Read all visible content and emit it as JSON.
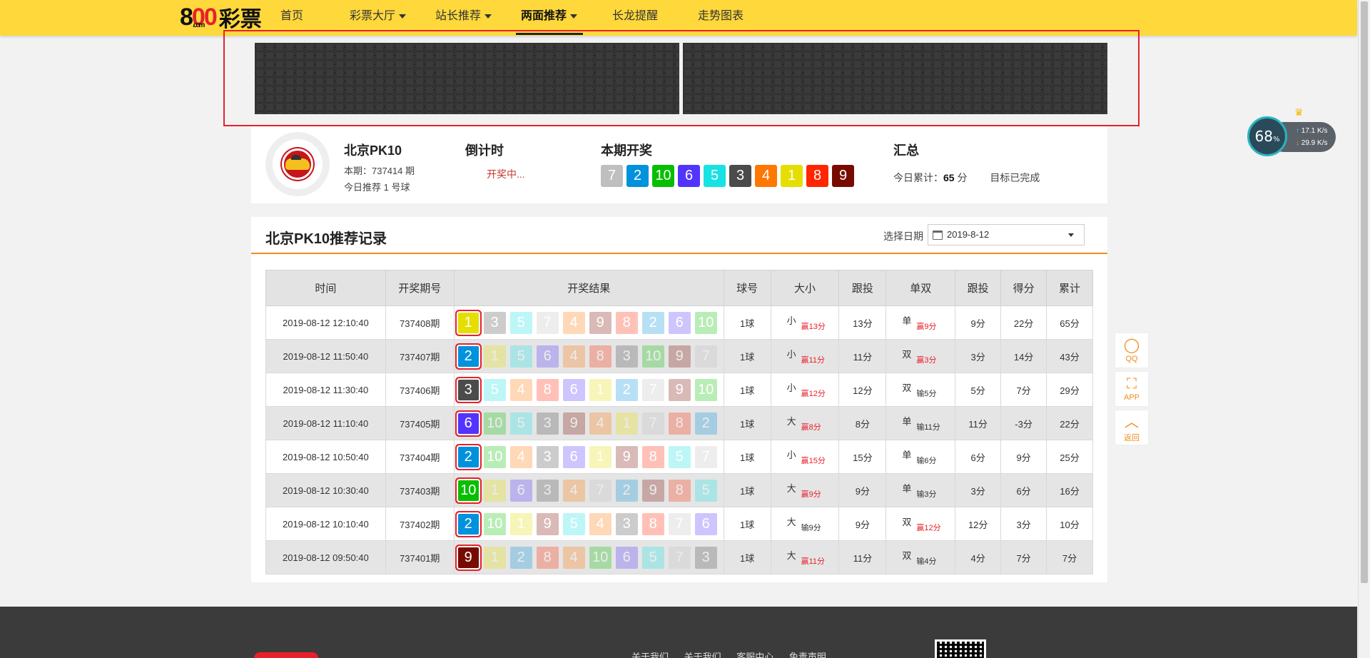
{
  "nav": {
    "logo_num": "8",
    "logo_oo": "00",
    "logo_com": ".com",
    "logo_text": "彩票",
    "items": [
      {
        "label": "首页",
        "dropdown": false,
        "active": false
      },
      {
        "label": "彩票大厅",
        "dropdown": true,
        "active": false
      },
      {
        "label": "站长推荐",
        "dropdown": true,
        "active": false
      },
      {
        "label": "两面推荐",
        "dropdown": true,
        "active": true
      },
      {
        "label": "长龙提醒",
        "dropdown": false,
        "active": false
      },
      {
        "label": "走势图表",
        "dropdown": false,
        "active": false
      }
    ]
  },
  "game": {
    "name": "北京PK10",
    "issue": "本期：737414 期",
    "today": "今日推荐 1 号球"
  },
  "countdown": {
    "title": "倒计时",
    "value": "开奖中..."
  },
  "current_draw": {
    "title": "本期开奖",
    "balls": [
      7,
      2,
      10,
      6,
      5,
      3,
      4,
      1,
      8,
      9
    ]
  },
  "summary": {
    "title": "汇总",
    "prefix": "今日累计：",
    "score": "65",
    "unit": " 分",
    "goal": "目标已完成"
  },
  "ball_colors": {
    "1": "#e6de00",
    "2": "#0092dd",
    "3": "#4b4b4b",
    "4": "#ff7600",
    "5": "#17e2e5",
    "6": "#5234ff",
    "7": "#bfbfbf",
    "8": "#ff2600",
    "9": "#780b00",
    "10": "#07bf00"
  },
  "record": {
    "title": "北京PK10推荐记录",
    "date_label": "选择日期",
    "date_value": "2019-8-12",
    "headers": [
      "时间",
      "开奖期号",
      "开奖结果",
      "球号",
      "大小",
      "跟投",
      "单双",
      "跟投",
      "得分",
      "累计"
    ],
    "rows": [
      {
        "time": "2019-08-12 12:10:40",
        "issue": "737408期",
        "balls": [
          1,
          3,
          5,
          7,
          4,
          9,
          8,
          2,
          6,
          10
        ],
        "ball_no": "1球",
        "size": "小",
        "size_res": "赢13分",
        "size_win": true,
        "size_bet": "13分",
        "parity": "单",
        "parity_res": "赢9分",
        "parity_win": true,
        "parity_bet": "9分",
        "score": "22分",
        "total": "65分"
      },
      {
        "time": "2019-08-12 11:50:40",
        "issue": "737407期",
        "balls": [
          2,
          1,
          5,
          6,
          4,
          8,
          3,
          10,
          9,
          7
        ],
        "ball_no": "1球",
        "size": "小",
        "size_res": "赢11分",
        "size_win": true,
        "size_bet": "11分",
        "parity": "双",
        "parity_res": "赢3分",
        "parity_win": true,
        "parity_bet": "3分",
        "score": "14分",
        "total": "43分"
      },
      {
        "time": "2019-08-12 11:30:40",
        "issue": "737406期",
        "balls": [
          3,
          5,
          4,
          8,
          6,
          1,
          2,
          7,
          9,
          10
        ],
        "ball_no": "1球",
        "size": "小",
        "size_res": "赢12分",
        "size_win": true,
        "size_bet": "12分",
        "parity": "双",
        "parity_res": "输5分",
        "parity_win": false,
        "parity_bet": "5分",
        "score": "7分",
        "total": "29分"
      },
      {
        "time": "2019-08-12 11:10:40",
        "issue": "737405期",
        "balls": [
          6,
          10,
          5,
          3,
          9,
          4,
          1,
          7,
          8,
          2
        ],
        "ball_no": "1球",
        "size": "大",
        "size_res": "赢8分",
        "size_win": true,
        "size_bet": "8分",
        "parity": "单",
        "parity_res": "输11分",
        "parity_win": false,
        "parity_bet": "11分",
        "score": "-3分",
        "total": "22分"
      },
      {
        "time": "2019-08-12 10:50:40",
        "issue": "737404期",
        "balls": [
          2,
          10,
          4,
          3,
          6,
          1,
          9,
          8,
          5,
          7
        ],
        "ball_no": "1球",
        "size": "小",
        "size_res": "赢15分",
        "size_win": true,
        "size_bet": "15分",
        "parity": "单",
        "parity_res": "输6分",
        "parity_win": false,
        "parity_bet": "6分",
        "score": "9分",
        "total": "25分"
      },
      {
        "time": "2019-08-12 10:30:40",
        "issue": "737403期",
        "balls": [
          10,
          1,
          6,
          3,
          4,
          7,
          2,
          9,
          8,
          5
        ],
        "ball_no": "1球",
        "size": "大",
        "size_res": "赢9分",
        "size_win": true,
        "size_bet": "9分",
        "parity": "单",
        "parity_res": "输3分",
        "parity_win": false,
        "parity_bet": "3分",
        "score": "6分",
        "total": "16分"
      },
      {
        "time": "2019-08-12 10:10:40",
        "issue": "737402期",
        "balls": [
          2,
          10,
          1,
          9,
          5,
          4,
          3,
          8,
          7,
          6
        ],
        "ball_no": "1球",
        "size": "大",
        "size_res": "输9分",
        "size_win": false,
        "size_bet": "9分",
        "parity": "双",
        "parity_res": "赢12分",
        "parity_win": true,
        "parity_bet": "12分",
        "score": "3分",
        "total": "10分"
      },
      {
        "time": "2019-08-12 09:50:40",
        "issue": "737401期",
        "balls": [
          9,
          1,
          2,
          8,
          4,
          10,
          6,
          5,
          7,
          3
        ],
        "ball_no": "1球",
        "size": "大",
        "size_res": "赢11分",
        "size_win": true,
        "size_bet": "11分",
        "parity": "双",
        "parity_res": "输4分",
        "parity_win": false,
        "parity_bet": "4分",
        "score": "7分",
        "total": "7分"
      }
    ]
  },
  "side_tools": {
    "qq": "QQ",
    "app": "APP",
    "back": "返回"
  },
  "speed_widget": {
    "percent": "68",
    "percent_unit": "%",
    "up": "17.1",
    "down": "29.9",
    "unit": "K/s"
  },
  "footer": {
    "links": [
      "关于我们",
      "关于我们",
      "客服中心",
      "免责声明"
    ]
  }
}
